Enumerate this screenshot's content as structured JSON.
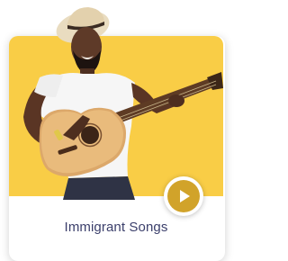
{
  "card": {
    "title": "Immigrant Songs",
    "image": "man-playing-acoustic-guitar",
    "play_icon": "play-icon"
  },
  "colors": {
    "panel_bg": "#f9cd46",
    "play_ring": "#d1a32a",
    "title_text": "#3b3f6b",
    "card_bg": "#ffffff"
  }
}
